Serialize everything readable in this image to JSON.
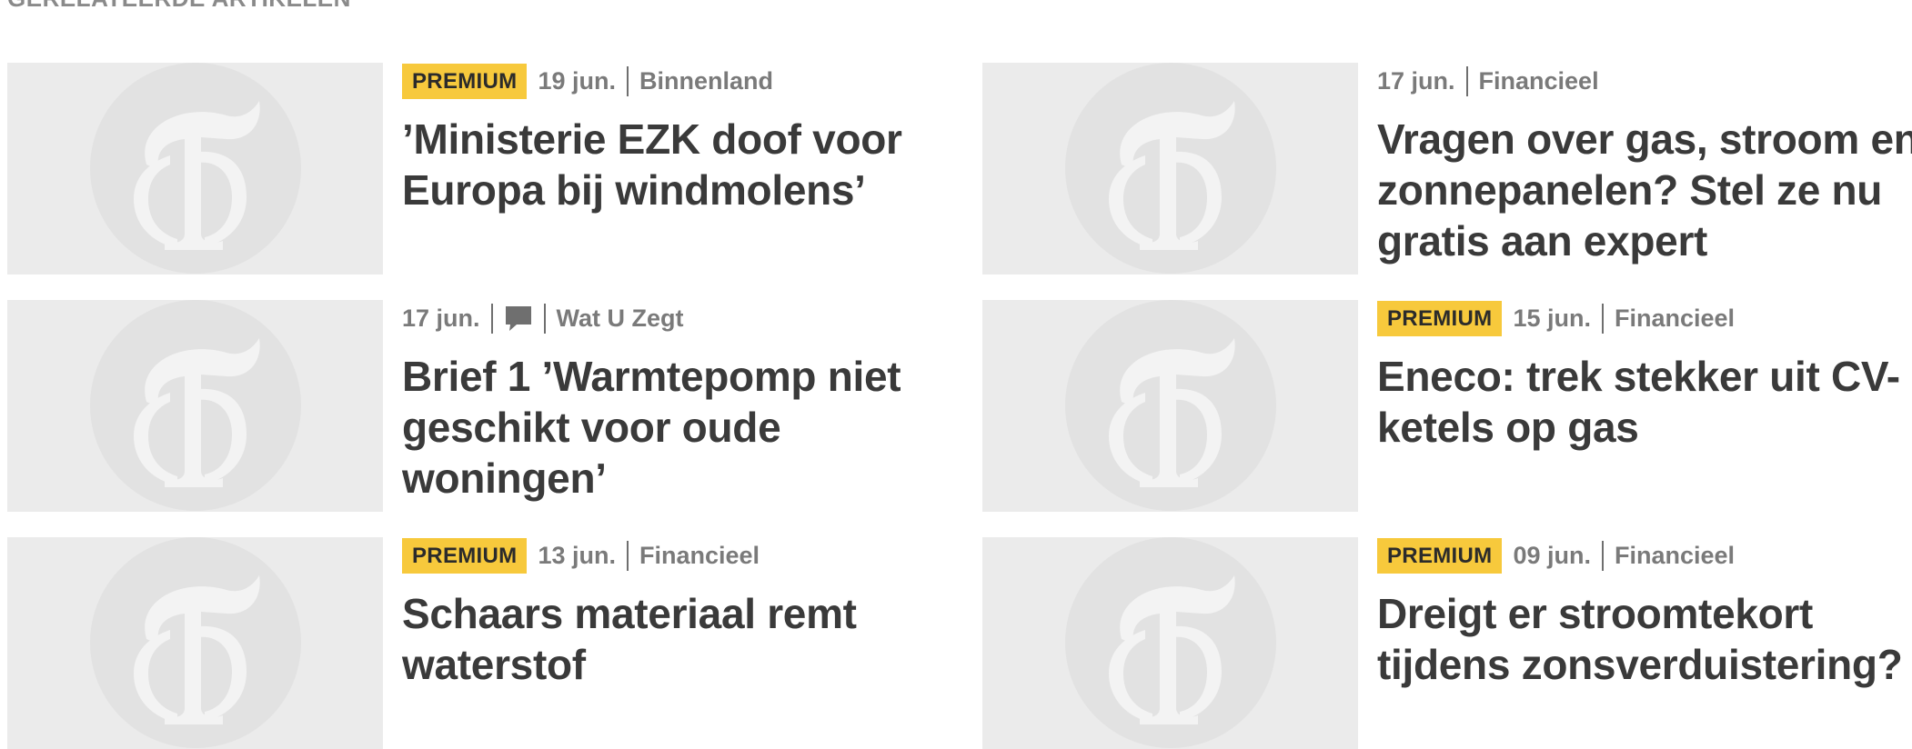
{
  "section": {
    "heading": "GERELATEERDE ARTIKELEN"
  },
  "articles": [
    {
      "premium": "PREMIUM",
      "date": "19 jun.",
      "category": "Binnenland",
      "title": "’Ministerie EZK doof voor Europa bij windmolens’"
    },
    {
      "premium": "",
      "date": "17 jun.",
      "category": "Financieel",
      "title": "Vragen over gas, stroom en zonnepanelen? Stel ze nu gratis aan expert"
    },
    {
      "premium": "",
      "date": "17 jun.",
      "comment_icon": "comment-bubble-icon",
      "category": "Wat U Zegt",
      "title": "Brief 1 ’Warmtepomp niet geschikt voor oude woningen’"
    },
    {
      "premium": "PREMIUM",
      "date": "15 jun.",
      "category": "Financieel",
      "title": "Eneco: trek stekker uit CV-ketels op gas"
    },
    {
      "premium": "PREMIUM",
      "date": "13 jun.",
      "category": "Financieel",
      "title": "Schaars materiaal remt waterstof"
    },
    {
      "premium": "PREMIUM",
      "date": "09 jun.",
      "category": "Financieel",
      "title": "Dreigt er stroomtekort tijdens zonsverduistering?"
    }
  ],
  "placeholder_icon": "telegraaf-t-logo-icon",
  "colors": {
    "badge": "#f7c93c",
    "thumb_bg": "#ebebeb",
    "thumb_circle": "#e2e2e2",
    "title": "#3a3a3a",
    "meta": "#7a7a7a"
  }
}
